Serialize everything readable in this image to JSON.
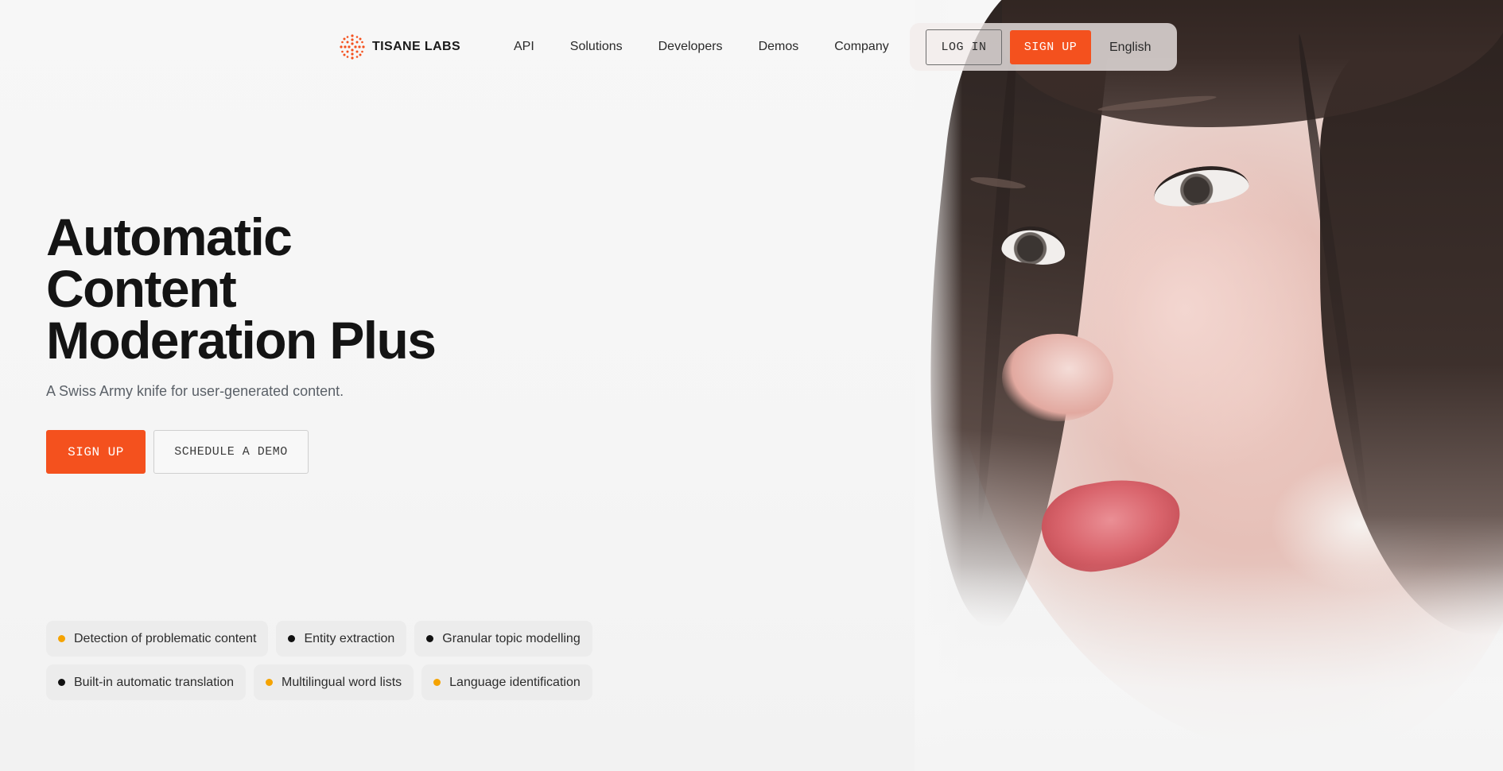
{
  "brand": {
    "name": "TISANE LABS",
    "accent_color": "#f4511e"
  },
  "nav": {
    "links": [
      "API",
      "Solutions",
      "Developers",
      "Demos",
      "Company"
    ],
    "login_label": "LOG IN",
    "signup_label": "SIGN UP",
    "language": "English"
  },
  "hero": {
    "title_lines": [
      "Automatic",
      "Content",
      "Moderation Plus"
    ],
    "subtitle": "A Swiss Army knife for user-generated content.",
    "signup_label": "SIGN UP",
    "demo_label": "SCHEDULE A DEMO",
    "image": "3d-rendered-woman-portrait"
  },
  "features": [
    [
      {
        "label": "Detection of problematic content",
        "dot_color": "#f5a300"
      },
      {
        "label": "Entity extraction",
        "dot_color": "#111111"
      },
      {
        "label": "Granular topic modelling",
        "dot_color": "#111111"
      }
    ],
    [
      {
        "label": "Built-in automatic translation",
        "dot_color": "#111111"
      },
      {
        "label": "Multilingual word lists",
        "dot_color": "#f5a300"
      },
      {
        "label": "Language identification",
        "dot_color": "#f5a300"
      }
    ]
  ]
}
